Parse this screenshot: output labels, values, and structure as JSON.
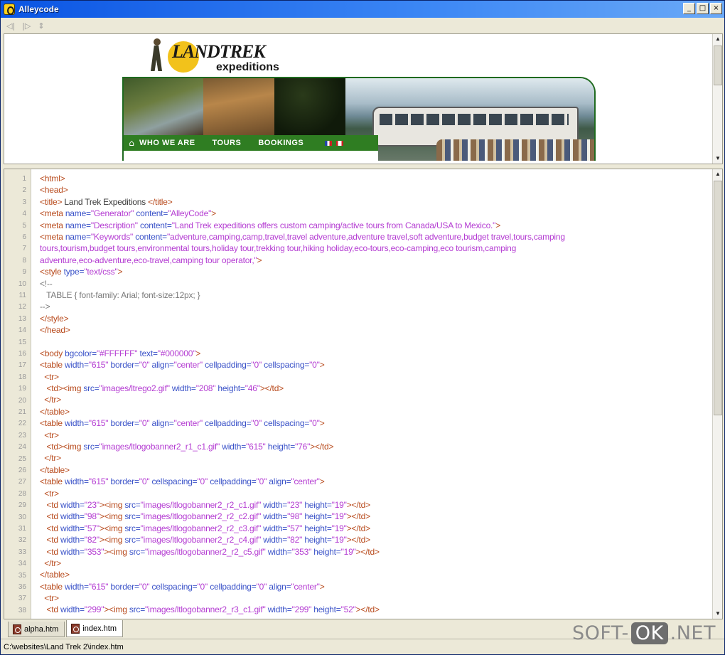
{
  "window": {
    "title": "Alleycode",
    "minimize": "_",
    "maximize": "□",
    "close": "×"
  },
  "toolbar": {
    "back": "◁|",
    "forward": "|▷",
    "refresh": "⇕"
  },
  "preview": {
    "logo_main": "LANDTREK",
    "logo_sub": "expeditions",
    "nav_home": "⌂",
    "nav_items": [
      "WHO WE ARE",
      "TOURS",
      "BOOKINGS"
    ]
  },
  "line_numbers": [
    "1",
    "2",
    "3",
    "4",
    "5",
    "6",
    "7",
    "8",
    "9",
    "10",
    "11",
    "12",
    "13",
    "14",
    "15",
    "16",
    "17",
    "18",
    "19",
    "20",
    "21",
    "22",
    "23",
    "24",
    "25",
    "26",
    "27",
    "28",
    "29",
    "30",
    "31",
    "32",
    "33",
    "34",
    "35",
    "36",
    "37",
    "38"
  ],
  "code_lines": [
    [
      [
        "t",
        "<html>"
      ]
    ],
    [
      [
        "t",
        "<head>"
      ]
    ],
    [
      [
        "t",
        "<title>"
      ],
      [
        "x",
        " Land Trek Expeditions "
      ],
      [
        "t",
        "</title>"
      ]
    ],
    [
      [
        "t",
        "<meta "
      ],
      [
        "a",
        "name="
      ],
      [
        "v",
        "\"Generator\""
      ],
      [
        "a",
        " content="
      ],
      [
        "v",
        "\"AlleyCode\""
      ],
      [
        "t",
        ">"
      ]
    ],
    [
      [
        "t",
        "<meta "
      ],
      [
        "a",
        "name="
      ],
      [
        "v",
        "\"Description\""
      ],
      [
        "a",
        " content="
      ],
      [
        "v",
        "\"Land Trek expeditions offers custom camping/active tours from Canada/USA to Mexico.\""
      ],
      [
        "t",
        ">"
      ]
    ],
    [
      [
        "t",
        "<meta "
      ],
      [
        "a",
        "name="
      ],
      [
        "v",
        "\"Keywords\""
      ],
      [
        "a",
        " content="
      ],
      [
        "v",
        "\"adventure,camping,camp,travel,travel adventure,adventure travel,soft adventure,budget travel,tours,camping"
      ]
    ],
    [
      [
        "v",
        "tours,tourism,budget tours,environmental tours,holiday tour,trekking tour,hiking holiday,eco-tours,eco-camping,eco tourism,camping"
      ]
    ],
    [
      [
        "v",
        "adventure,eco-adventure,eco-travel,camping tour operator,\""
      ],
      [
        "t",
        ">"
      ]
    ],
    [
      [
        "t",
        "<style "
      ],
      [
        "a",
        "type="
      ],
      [
        "v",
        "\"text/css\""
      ],
      [
        "t",
        ">"
      ]
    ],
    [
      [
        "c",
        "<!--"
      ]
    ],
    [
      [
        "c",
        "   TABLE { font-family: Arial; font-size:12px; }"
      ]
    ],
    [
      [
        "c",
        "-->"
      ]
    ],
    [
      [
        "t",
        "</style>"
      ]
    ],
    [
      [
        "t",
        "</head>"
      ]
    ],
    [
      [
        "x",
        ""
      ]
    ],
    [
      [
        "t",
        "<body "
      ],
      [
        "a",
        "bgcolor="
      ],
      [
        "v",
        "\"#FFFFFF\""
      ],
      [
        "a",
        " text="
      ],
      [
        "v",
        "\"#000000\""
      ],
      [
        "t",
        ">"
      ]
    ],
    [
      [
        "t",
        "<table "
      ],
      [
        "a",
        "width="
      ],
      [
        "v",
        "\"615\""
      ],
      [
        "a",
        " border="
      ],
      [
        "v",
        "\"0\""
      ],
      [
        "a",
        " align="
      ],
      [
        "v",
        "\"center\""
      ],
      [
        "a",
        " cellpadding="
      ],
      [
        "v",
        "\"0\""
      ],
      [
        "a",
        " cellspacing="
      ],
      [
        "v",
        "\"0\""
      ],
      [
        "t",
        ">"
      ]
    ],
    [
      [
        "t",
        "  <tr>"
      ]
    ],
    [
      [
        "t",
        "   <td><img "
      ],
      [
        "a",
        "src="
      ],
      [
        "v",
        "\"images/ltrego2.gif\""
      ],
      [
        "a",
        " width="
      ],
      [
        "v",
        "\"208\""
      ],
      [
        "a",
        " height="
      ],
      [
        "v",
        "\"46\""
      ],
      [
        "t",
        "></td>"
      ]
    ],
    [
      [
        "t",
        "  </tr>"
      ]
    ],
    [
      [
        "t",
        "</table>"
      ]
    ],
    [
      [
        "t",
        "<table "
      ],
      [
        "a",
        "width="
      ],
      [
        "v",
        "\"615\""
      ],
      [
        "a",
        " border="
      ],
      [
        "v",
        "\"0\""
      ],
      [
        "a",
        " align="
      ],
      [
        "v",
        "\"center\""
      ],
      [
        "a",
        " cellpadding="
      ],
      [
        "v",
        "\"0\""
      ],
      [
        "a",
        " cellspacing="
      ],
      [
        "v",
        "\"0\""
      ],
      [
        "t",
        ">"
      ]
    ],
    [
      [
        "t",
        "  <tr>"
      ]
    ],
    [
      [
        "t",
        "   <td><img "
      ],
      [
        "a",
        "src="
      ],
      [
        "v",
        "\"images/ltlogobanner2_r1_c1.gif\""
      ],
      [
        "a",
        " width="
      ],
      [
        "v",
        "\"615\""
      ],
      [
        "a",
        " height="
      ],
      [
        "v",
        "\"76\""
      ],
      [
        "t",
        "></td>"
      ]
    ],
    [
      [
        "t",
        "  </tr>"
      ]
    ],
    [
      [
        "t",
        "</table>"
      ]
    ],
    [
      [
        "t",
        "<table "
      ],
      [
        "a",
        "width="
      ],
      [
        "v",
        "\"615\""
      ],
      [
        "a",
        " border="
      ],
      [
        "v",
        "\"0\""
      ],
      [
        "a",
        " cellspacing="
      ],
      [
        "v",
        "\"0\""
      ],
      [
        "a",
        " cellpadding="
      ],
      [
        "v",
        "\"0\""
      ],
      [
        "a",
        " align="
      ],
      [
        "v",
        "\"center\""
      ],
      [
        "t",
        ">"
      ]
    ],
    [
      [
        "t",
        "  <tr>"
      ]
    ],
    [
      [
        "t",
        "   <td "
      ],
      [
        "a",
        "width="
      ],
      [
        "v",
        "\"23\""
      ],
      [
        "t",
        "><img "
      ],
      [
        "a",
        "src="
      ],
      [
        "v",
        "\"images/ltlogobanner2_r2_c1.gif\""
      ],
      [
        "a",
        " width="
      ],
      [
        "v",
        "\"23\""
      ],
      [
        "a",
        " height="
      ],
      [
        "v",
        "\"19\""
      ],
      [
        "t",
        "></td>"
      ]
    ],
    [
      [
        "t",
        "   <td "
      ],
      [
        "a",
        "width="
      ],
      [
        "v",
        "\"98\""
      ],
      [
        "t",
        "><img "
      ],
      [
        "a",
        "src="
      ],
      [
        "v",
        "\"images/ltlogobanner2_r2_c2.gif\""
      ],
      [
        "a",
        " width="
      ],
      [
        "v",
        "\"98\""
      ],
      [
        "a",
        " height="
      ],
      [
        "v",
        "\"19\""
      ],
      [
        "t",
        "></td>"
      ]
    ],
    [
      [
        "t",
        "   <td "
      ],
      [
        "a",
        "width="
      ],
      [
        "v",
        "\"57\""
      ],
      [
        "t",
        "><img "
      ],
      [
        "a",
        "src="
      ],
      [
        "v",
        "\"images/ltlogobanner2_r2_c3.gif\""
      ],
      [
        "a",
        " width="
      ],
      [
        "v",
        "\"57\""
      ],
      [
        "a",
        " height="
      ],
      [
        "v",
        "\"19\""
      ],
      [
        "t",
        "></td>"
      ]
    ],
    [
      [
        "t",
        "   <td "
      ],
      [
        "a",
        "width="
      ],
      [
        "v",
        "\"82\""
      ],
      [
        "t",
        "><img "
      ],
      [
        "a",
        "src="
      ],
      [
        "v",
        "\"images/ltlogobanner2_r2_c4.gif\""
      ],
      [
        "a",
        " width="
      ],
      [
        "v",
        "\"82\""
      ],
      [
        "a",
        " height="
      ],
      [
        "v",
        "\"19\""
      ],
      [
        "t",
        "></td>"
      ]
    ],
    [
      [
        "t",
        "   <td "
      ],
      [
        "a",
        "width="
      ],
      [
        "v",
        "\"353\""
      ],
      [
        "t",
        "><img "
      ],
      [
        "a",
        "src="
      ],
      [
        "v",
        "\"images/ltlogobanner2_r2_c5.gif\""
      ],
      [
        "a",
        " width="
      ],
      [
        "v",
        "\"353\""
      ],
      [
        "a",
        " height="
      ],
      [
        "v",
        "\"19\""
      ],
      [
        "t",
        "></td>"
      ]
    ],
    [
      [
        "t",
        "  </tr>"
      ]
    ],
    [
      [
        "t",
        "</table>"
      ]
    ],
    [
      [
        "t",
        "<table "
      ],
      [
        "a",
        "width="
      ],
      [
        "v",
        "\"615\""
      ],
      [
        "a",
        " border="
      ],
      [
        "v",
        "\"0\""
      ],
      [
        "a",
        " cellspacing="
      ],
      [
        "v",
        "\"0\""
      ],
      [
        "a",
        " cellpadding="
      ],
      [
        "v",
        "\"0\""
      ],
      [
        "a",
        " align="
      ],
      [
        "v",
        "\"center\""
      ],
      [
        "t",
        ">"
      ]
    ],
    [
      [
        "t",
        "  <tr>"
      ]
    ],
    [
      [
        "t",
        "   <td "
      ],
      [
        "a",
        "width="
      ],
      [
        "v",
        "\"299\""
      ],
      [
        "t",
        "><img "
      ],
      [
        "a",
        "src="
      ],
      [
        "v",
        "\"images/ltlogobanner2_r3_c1.gif\""
      ],
      [
        "a",
        " width="
      ],
      [
        "v",
        "\"299\""
      ],
      [
        "a",
        " height="
      ],
      [
        "v",
        "\"52\""
      ],
      [
        "t",
        "></td>"
      ]
    ]
  ],
  "tabs": [
    {
      "label": "alpha.htm",
      "active": false
    },
    {
      "label": "index.htm",
      "active": true
    }
  ],
  "status": {
    "path": "C:\\websites\\Land Trek 2\\index.htm"
  },
  "watermark": {
    "pre": "SOFT-",
    "ok": "OK",
    "post": ".NET"
  },
  "colors": {
    "tag": "#b84a1c",
    "attribute": "#3a52c8",
    "value": "#b43cd2",
    "comment": "#7a7a7a",
    "titlebar": "#0a54e3",
    "nav_green": "#2f7d22"
  }
}
